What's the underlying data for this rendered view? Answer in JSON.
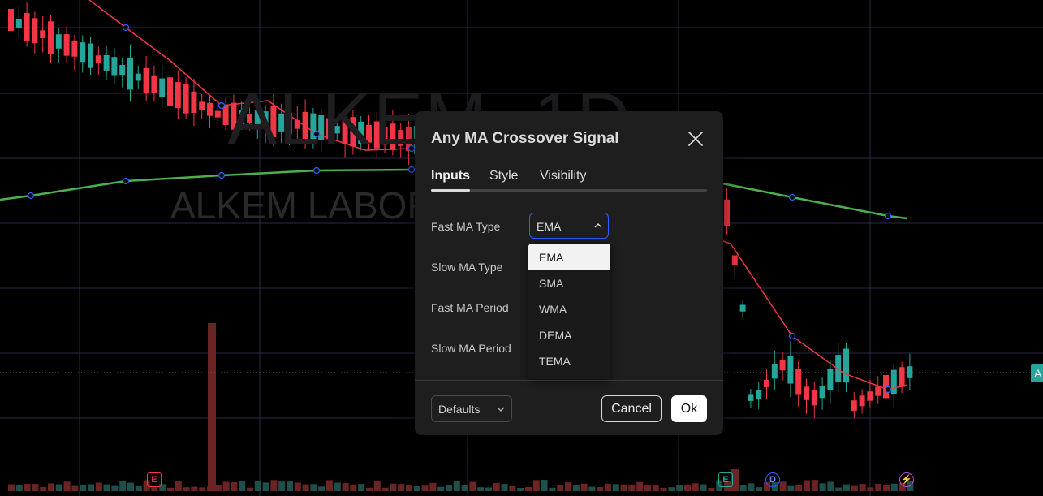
{
  "chart": {
    "watermark_symbol": "ALKEM, 1D",
    "watermark_name": "ALKEM LABORATORIES LTD",
    "price_tag_text": "A",
    "colors": {
      "up": "#26a69a",
      "down": "#f23645",
      "fast_ma": "#f23645",
      "slow_ma": "#4caf50",
      "grid": "#2a2a4a"
    },
    "markers": [
      {
        "type": "earnings",
        "icon": "E",
        "style": "earn"
      },
      {
        "type": "earnings",
        "icon": "E",
        "style": "earn2"
      },
      {
        "type": "dividend",
        "icon": "D",
        "style": "div"
      },
      {
        "type": "split",
        "icon": "⚡",
        "style": "split"
      }
    ]
  },
  "dialog": {
    "title": "Any MA Crossover Signal",
    "tabs": [
      {
        "label": "Inputs",
        "active": true
      },
      {
        "label": "Style",
        "active": false
      },
      {
        "label": "Visibility",
        "active": false
      }
    ],
    "rows": [
      {
        "label": "Fast MA Type"
      },
      {
        "label": "Slow MA Type"
      },
      {
        "label": "Fast MA Period"
      },
      {
        "label": "Slow MA Period"
      }
    ],
    "fast_ma_type": {
      "value": "EMA",
      "options": [
        "EMA",
        "SMA",
        "WMA",
        "DEMA",
        "TEMA"
      ],
      "selected_index": 0
    },
    "footer": {
      "defaults_label": "Defaults",
      "cancel_label": "Cancel",
      "ok_label": "Ok"
    }
  }
}
